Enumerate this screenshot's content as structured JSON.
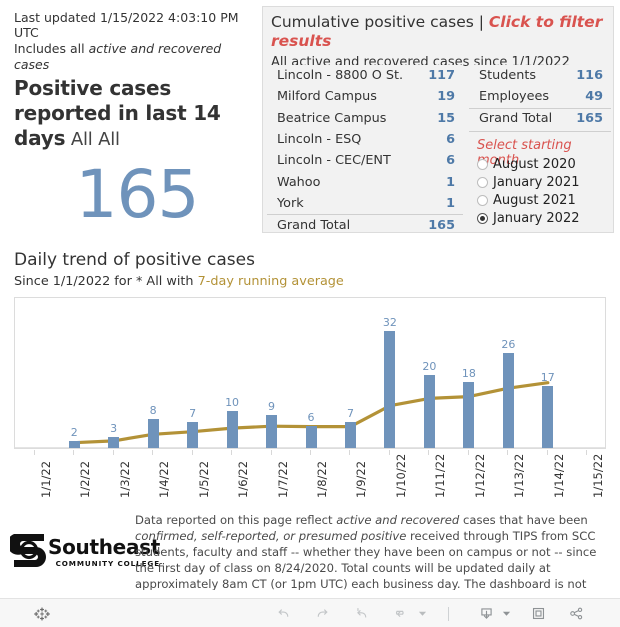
{
  "kpi": {
    "last_updated": "Last updated 1/15/2022 4:03:10 PM UTC",
    "includes_prefix": "Includes all ",
    "includes_em": "active and recovered cases",
    "title_bold": "Positive cases reported in last 14 days",
    "title_sub": " All All",
    "value": "165"
  },
  "right_panel": {
    "title_main": "Cumulative positive cases | ",
    "title_click": "Click to filter results",
    "subtitle": "All active and recovered cases since 1/1/2022",
    "locations": [
      {
        "label": "Lincoln - 8800 O St.",
        "value": "117"
      },
      {
        "label": "Milford Campus",
        "value": "19"
      },
      {
        "label": "Beatrice Campus",
        "value": "15"
      },
      {
        "label": "Lincoln - ESQ",
        "value": "6"
      },
      {
        "label": "Lincoln - CEC/ENT",
        "value": "6"
      },
      {
        "label": "Wahoo",
        "value": "1"
      },
      {
        "label": "York",
        "value": "1"
      }
    ],
    "locations_total": {
      "label": "Grand Total",
      "value": "165"
    },
    "groups": [
      {
        "label": "Students",
        "value": "116"
      },
      {
        "label": "Employees",
        "value": "49"
      }
    ],
    "groups_total": {
      "label": "Grand Total",
      "value": "165"
    },
    "month_filter_title": "Select starting month",
    "month_options": [
      {
        "label": "August 2020",
        "selected": false
      },
      {
        "label": "January 2021",
        "selected": false
      },
      {
        "label": "August 2021",
        "selected": false
      },
      {
        "label": "January 2022",
        "selected": true
      }
    ]
  },
  "chart_header": {
    "title": "Daily trend of positive cases",
    "sub_prefix": "Since 1/1/2022 for * All with ",
    "sub_avg": "7-day running average"
  },
  "chart_data": {
    "type": "bar",
    "title": "Daily trend of positive cases",
    "subtitle": "Since 1/1/2022 for * All with 7-day running average",
    "xlabel": "",
    "ylabel": "",
    "grid": false,
    "ylim": [
      0,
      35
    ],
    "categories": [
      "1/1/22",
      "1/2/22",
      "1/3/22",
      "1/4/22",
      "1/5/22",
      "1/6/22",
      "1/7/22",
      "1/8/22",
      "1/9/22",
      "1/10/22",
      "1/11/22",
      "1/12/22",
      "1/13/22",
      "1/14/22",
      "1/15/22"
    ],
    "series": [
      {
        "name": "Daily positive cases",
        "type": "bar",
        "color": "#6f93bb",
        "values": [
          null,
          2,
          3,
          8,
          7,
          10,
          9,
          6,
          7,
          32,
          20,
          18,
          26,
          17,
          null
        ],
        "labels": [
          "",
          "2",
          "3",
          "8",
          "7",
          "10",
          "9",
          "6",
          "7",
          "32",
          "20",
          "18",
          "26",
          "17",
          ""
        ]
      },
      {
        "name": "7-day running average",
        "type": "line",
        "color": "#b39237",
        "values": [
          null,
          2.0,
          2.5,
          4.3,
          5.0,
          6.0,
          6.5,
          6.4,
          6.4,
          12.1,
          14.1,
          14.6,
          16.9,
          18.4,
          null
        ]
      }
    ],
    "legend_position": "none"
  },
  "footer": {
    "logo_name": "Southeast",
    "logo_sub": "COMMUNITY COLLEGE",
    "note_parts": [
      {
        "t": "Data reported on this page reflect ",
        "i": false
      },
      {
        "t": "active and recovered",
        "i": true
      },
      {
        "t": " cases that have been ",
        "i": false
      },
      {
        "t": "confirmed, self-reported, or presumed positive",
        "i": true
      },
      {
        "t": " received through TIPS from SCC students, faculty and staff -- whether they have been on campus or not --  since the first day of class on 8/24/2020. Total counts will be updated daily at approximately 8am CT (or 1pm UTC) each business day. The dashboard is not updated on weekends or holidays. Data from previous days may be updated as",
        "i": false
      }
    ]
  },
  "toolbar": {
    "tableau_logo": "tableau-logo-icon",
    "undo": "undo-icon",
    "redo": "redo-icon",
    "revert": "revert-icon",
    "refresh": "refresh-icon",
    "pause_dropdown": "chevron-down-icon",
    "download": "download-icon",
    "download_dropdown": "chevron-down-icon",
    "fullscreen": "fullscreen-icon",
    "share": "share-icon"
  }
}
